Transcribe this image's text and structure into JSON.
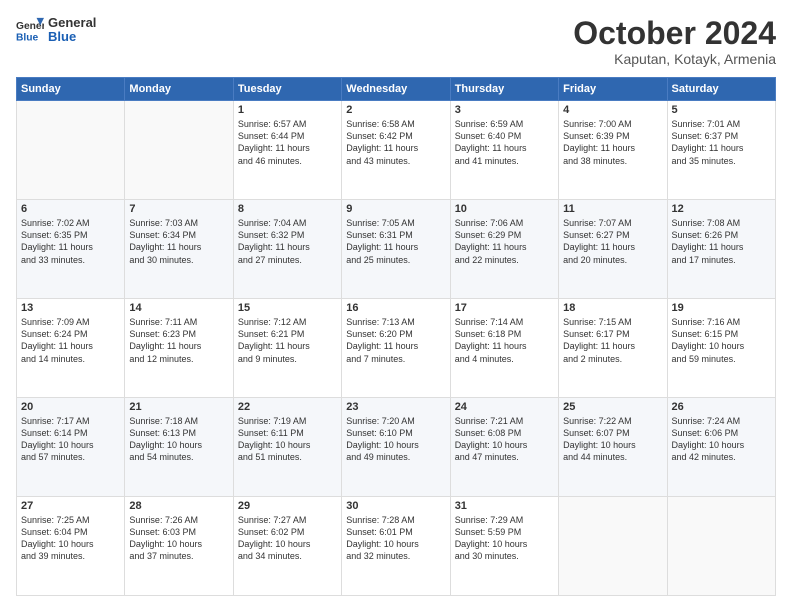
{
  "logo": {
    "line1": "General",
    "line2": "Blue"
  },
  "header": {
    "month": "October 2024",
    "location": "Kaputan, Kotayk, Armenia"
  },
  "weekdays": [
    "Sunday",
    "Monday",
    "Tuesday",
    "Wednesday",
    "Thursday",
    "Friday",
    "Saturday"
  ],
  "rows": [
    [
      {
        "day": "",
        "text": ""
      },
      {
        "day": "",
        "text": ""
      },
      {
        "day": "1",
        "text": "Sunrise: 6:57 AM\nSunset: 6:44 PM\nDaylight: 11 hours\nand 46 minutes."
      },
      {
        "day": "2",
        "text": "Sunrise: 6:58 AM\nSunset: 6:42 PM\nDaylight: 11 hours\nand 43 minutes."
      },
      {
        "day": "3",
        "text": "Sunrise: 6:59 AM\nSunset: 6:40 PM\nDaylight: 11 hours\nand 41 minutes."
      },
      {
        "day": "4",
        "text": "Sunrise: 7:00 AM\nSunset: 6:39 PM\nDaylight: 11 hours\nand 38 minutes."
      },
      {
        "day": "5",
        "text": "Sunrise: 7:01 AM\nSunset: 6:37 PM\nDaylight: 11 hours\nand 35 minutes."
      }
    ],
    [
      {
        "day": "6",
        "text": "Sunrise: 7:02 AM\nSunset: 6:35 PM\nDaylight: 11 hours\nand 33 minutes."
      },
      {
        "day": "7",
        "text": "Sunrise: 7:03 AM\nSunset: 6:34 PM\nDaylight: 11 hours\nand 30 minutes."
      },
      {
        "day": "8",
        "text": "Sunrise: 7:04 AM\nSunset: 6:32 PM\nDaylight: 11 hours\nand 27 minutes."
      },
      {
        "day": "9",
        "text": "Sunrise: 7:05 AM\nSunset: 6:31 PM\nDaylight: 11 hours\nand 25 minutes."
      },
      {
        "day": "10",
        "text": "Sunrise: 7:06 AM\nSunset: 6:29 PM\nDaylight: 11 hours\nand 22 minutes."
      },
      {
        "day": "11",
        "text": "Sunrise: 7:07 AM\nSunset: 6:27 PM\nDaylight: 11 hours\nand 20 minutes."
      },
      {
        "day": "12",
        "text": "Sunrise: 7:08 AM\nSunset: 6:26 PM\nDaylight: 11 hours\nand 17 minutes."
      }
    ],
    [
      {
        "day": "13",
        "text": "Sunrise: 7:09 AM\nSunset: 6:24 PM\nDaylight: 11 hours\nand 14 minutes."
      },
      {
        "day": "14",
        "text": "Sunrise: 7:11 AM\nSunset: 6:23 PM\nDaylight: 11 hours\nand 12 minutes."
      },
      {
        "day": "15",
        "text": "Sunrise: 7:12 AM\nSunset: 6:21 PM\nDaylight: 11 hours\nand 9 minutes."
      },
      {
        "day": "16",
        "text": "Sunrise: 7:13 AM\nSunset: 6:20 PM\nDaylight: 11 hours\nand 7 minutes."
      },
      {
        "day": "17",
        "text": "Sunrise: 7:14 AM\nSunset: 6:18 PM\nDaylight: 11 hours\nand 4 minutes."
      },
      {
        "day": "18",
        "text": "Sunrise: 7:15 AM\nSunset: 6:17 PM\nDaylight: 11 hours\nand 2 minutes."
      },
      {
        "day": "19",
        "text": "Sunrise: 7:16 AM\nSunset: 6:15 PM\nDaylight: 10 hours\nand 59 minutes."
      }
    ],
    [
      {
        "day": "20",
        "text": "Sunrise: 7:17 AM\nSunset: 6:14 PM\nDaylight: 10 hours\nand 57 minutes."
      },
      {
        "day": "21",
        "text": "Sunrise: 7:18 AM\nSunset: 6:13 PM\nDaylight: 10 hours\nand 54 minutes."
      },
      {
        "day": "22",
        "text": "Sunrise: 7:19 AM\nSunset: 6:11 PM\nDaylight: 10 hours\nand 51 minutes."
      },
      {
        "day": "23",
        "text": "Sunrise: 7:20 AM\nSunset: 6:10 PM\nDaylight: 10 hours\nand 49 minutes."
      },
      {
        "day": "24",
        "text": "Sunrise: 7:21 AM\nSunset: 6:08 PM\nDaylight: 10 hours\nand 47 minutes."
      },
      {
        "day": "25",
        "text": "Sunrise: 7:22 AM\nSunset: 6:07 PM\nDaylight: 10 hours\nand 44 minutes."
      },
      {
        "day": "26",
        "text": "Sunrise: 7:24 AM\nSunset: 6:06 PM\nDaylight: 10 hours\nand 42 minutes."
      }
    ],
    [
      {
        "day": "27",
        "text": "Sunrise: 7:25 AM\nSunset: 6:04 PM\nDaylight: 10 hours\nand 39 minutes."
      },
      {
        "day": "28",
        "text": "Sunrise: 7:26 AM\nSunset: 6:03 PM\nDaylight: 10 hours\nand 37 minutes."
      },
      {
        "day": "29",
        "text": "Sunrise: 7:27 AM\nSunset: 6:02 PM\nDaylight: 10 hours\nand 34 minutes."
      },
      {
        "day": "30",
        "text": "Sunrise: 7:28 AM\nSunset: 6:01 PM\nDaylight: 10 hours\nand 32 minutes."
      },
      {
        "day": "31",
        "text": "Sunrise: 7:29 AM\nSunset: 5:59 PM\nDaylight: 10 hours\nand 30 minutes."
      },
      {
        "day": "",
        "text": ""
      },
      {
        "day": "",
        "text": ""
      }
    ]
  ]
}
